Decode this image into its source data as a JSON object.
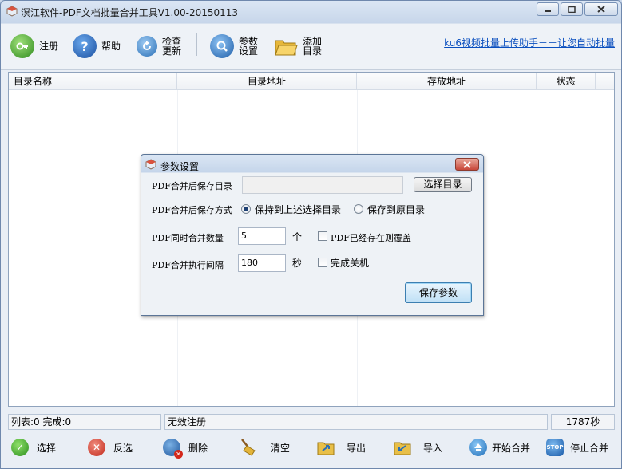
{
  "window": {
    "title": "溟江软件-PDF文档批量合并工具V1.00-20150113",
    "controls": {
      "minimize": "minimize",
      "maximize": "maximize",
      "close": "close"
    }
  },
  "toolbar": {
    "register": "注册",
    "help": "帮助",
    "check_update": "检查更新",
    "settings": "参数设置",
    "add_dir": "添加目录",
    "link": "ku6视频批量上传助手－－让您自动批量"
  },
  "grid": {
    "columns": [
      "目录名称",
      "目录地址",
      "存放地址",
      "状态"
    ]
  },
  "status": {
    "counts": "列表:0 完成:0",
    "register_state": "无效注册",
    "timer": "1787秒"
  },
  "bottom": {
    "select": "选择",
    "invert": "反选",
    "delete": "删除",
    "clear": "清空",
    "export": "导出",
    "import": "导入",
    "start": "开始合并",
    "stop": "停止合并"
  },
  "dialog": {
    "title": "参数设置",
    "save_dir_label": "PDF合并后保存目录",
    "save_dir_value": "",
    "choose_dir_button": "选择目录",
    "save_mode_label": "PDF合并后保存方式",
    "mode_option1": "保持到上述选择目录",
    "mode_option2": "保存到原目录",
    "concurrency_label": "PDF同时合并数量",
    "concurrency_value": "5",
    "concurrency_unit": "个",
    "overwrite_label": "PDF已经存在则覆盖",
    "interval_label": "PDF合并执行间隔",
    "interval_value": "180",
    "interval_unit": "秒",
    "shutdown_label": "完成关机",
    "save_button": "保存参数",
    "mode_selected": 1,
    "overwrite_checked": false,
    "shutdown_checked": false
  },
  "colors": {
    "link": "#0a4fbf",
    "accent": "#1c3f73"
  }
}
